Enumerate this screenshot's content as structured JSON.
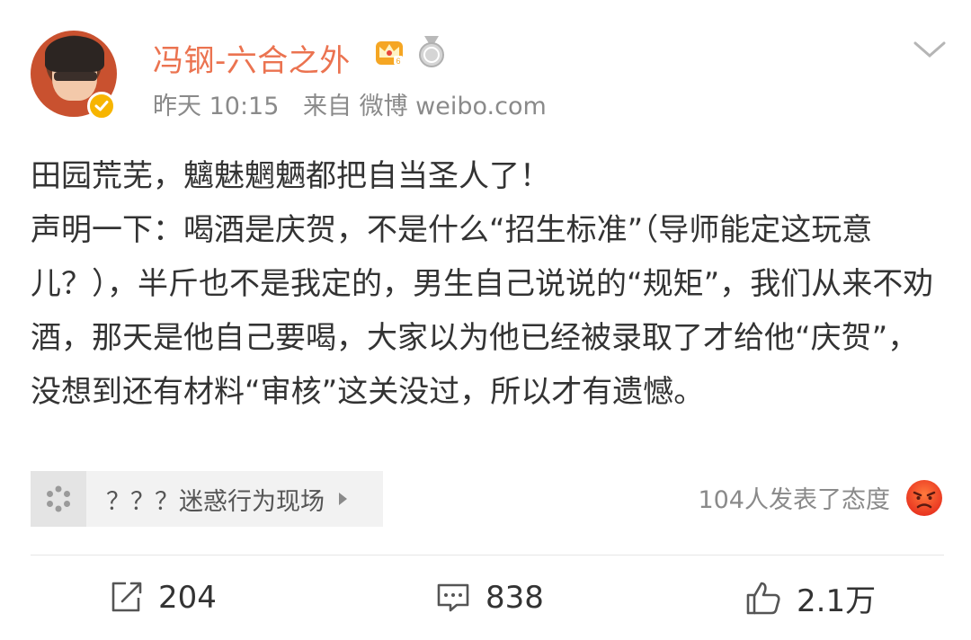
{
  "post": {
    "author": {
      "name": "冯钢-六合之外",
      "verified": true
    },
    "meta": {
      "time": "昨天 10:15",
      "source": "来自 微博 weibo.com"
    },
    "content": {
      "lines": [
        "田园荒芜，魑魅魍魉都把自当圣人了！",
        "声明一下：喝酒是庆贺，不是什么“招生标准”（导师能定这玩意儿？），半斤也不是我定的，男生自己说说的“规矩”，我们从来不劝酒，那天是他自己要喝，大家以为他已经被录取了才给他“庆贺”，没想到还有材料“审核”这关没过，所以才有遗憾。"
      ]
    },
    "topic": {
      "label": "？？？迷惑行为现场"
    },
    "reactions_text": "104人发表了态度",
    "actions": {
      "repost_count": "204",
      "comment_count": "838",
      "like_count": "2.1万"
    },
    "colors": {
      "username": "#eb7350",
      "meta": "#8a8a8a",
      "verified_badge": "#f7b500"
    },
    "icons": [
      "chevron-down-icon",
      "crown-icon",
      "medal-icon",
      "verified-icon",
      "topic-icon",
      "angry-face-icon",
      "repost-icon",
      "comment-icon",
      "like-icon"
    ]
  }
}
